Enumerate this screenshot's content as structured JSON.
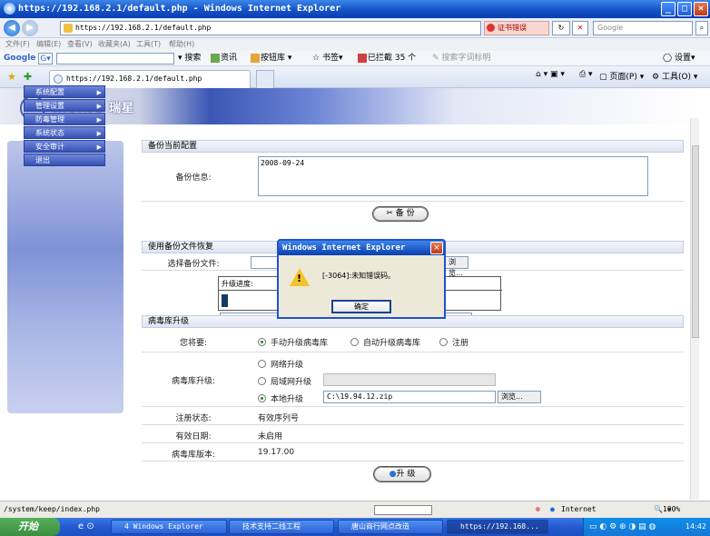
{
  "window": {
    "title": "https://192.168.2.1/default.php - Windows Internet Explorer"
  },
  "address": {
    "url": "https://192.168.2.1/default.php",
    "cert_error": "证书错误",
    "search_placeholder": "Google"
  },
  "menu": [
    "文件(F)",
    "编辑(E)",
    "查看(V)",
    "收藏夹(A)",
    "工具(T)",
    "帮助(H)"
  ],
  "google_toolbar": {
    "brand": "Google",
    "search_btn": "搜索",
    "news": "资讯",
    "bookmarks": "按钮库",
    "favorites": "书签",
    "blocked": "已拦截 35 个",
    "hint": "搜索字词标明",
    "settings": "设置"
  },
  "tabs": {
    "active": "https://192.168.2.1/default.php",
    "page": "页面(P)",
    "tools": "工具(O)"
  },
  "app": {
    "brand": "RISING 瑞星"
  },
  "sidebar": {
    "items": [
      "系统配置",
      "管理设置",
      "防毒管理",
      "系统状态",
      "安全审计",
      "退出"
    ]
  },
  "backup": {
    "section_title": "备份当前配置",
    "info_label": "备份信息:",
    "info_value": "2008-09-24",
    "button": "备 份"
  },
  "restore": {
    "section_title": "使用备份文件恢复",
    "file_label": "选择备份文件:",
    "browse": "浏览...",
    "progress_label": "升级进度:"
  },
  "virus_update": {
    "section_title": "病毒库升级",
    "want_label": "您将要:",
    "modes": [
      "手动升级病毒库",
      "自动升级病毒库",
      "注册"
    ],
    "update_label": "病毒库升级:",
    "sources": [
      "网络升级",
      "局域网升级",
      "本地升级"
    ],
    "local_path": "C:\\19.94.12.zip",
    "browse": "浏览...",
    "reg_status_label": "注册状态:",
    "reg_status_value": "有效序列号",
    "expire_label": "有效日期:",
    "expire_value": "未启用",
    "version_label": "病毒库版本:",
    "version_value": "19.17.00",
    "upgrade_button": "升 级"
  },
  "dialog": {
    "title": "Windows Internet Explorer",
    "message": "[-3064]:未知错误码。",
    "ok": "确定"
  },
  "status": {
    "url": "/system/keep/index.php",
    "zone": "Internet",
    "zoom": "100%"
  },
  "taskbar": {
    "start": "开始",
    "items": [
      "4 Windows Explorer",
      "技术支持二线工程",
      "唐山商行网点改造",
      "https://192.168..."
    ],
    "time": "14:42"
  }
}
